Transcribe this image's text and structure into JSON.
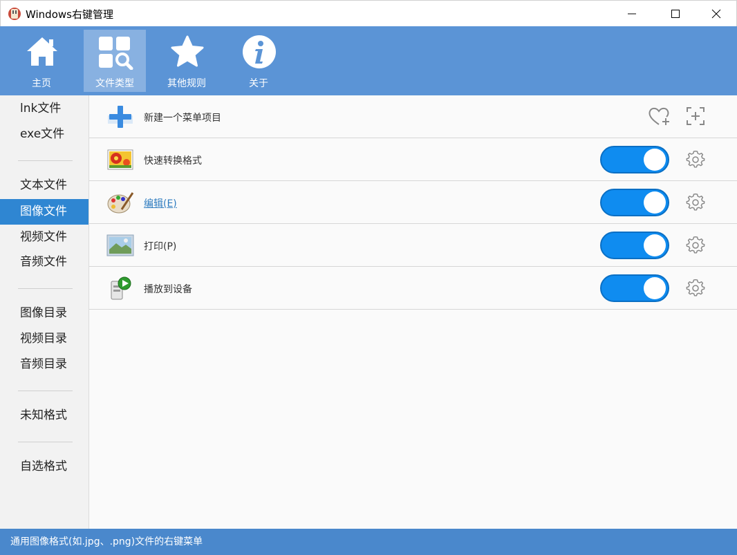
{
  "window": {
    "title": "Windows右键管理",
    "controls": [
      "minimize",
      "maximize",
      "close"
    ]
  },
  "toolbar": {
    "items": [
      {
        "label": "主页",
        "icon": "home-icon",
        "active": false
      },
      {
        "label": "文件类型",
        "icon": "file-types-search-icon",
        "active": true
      },
      {
        "label": "其他规则",
        "icon": "star-icon",
        "active": false
      },
      {
        "label": "关于",
        "icon": "info-icon",
        "active": false
      }
    ]
  },
  "sidebar": {
    "groups": [
      [
        "lnk文件",
        "exe文件"
      ],
      [
        "文本文件",
        "图像文件",
        "视频文件",
        "音频文件"
      ],
      [
        "图像目录",
        "视频目录",
        "音频目录"
      ],
      [
        "未知格式"
      ],
      [
        "自选格式"
      ]
    ],
    "selected": "图像文件"
  },
  "main": {
    "new_item": {
      "label": "新建一个菜单项目",
      "icon": "add-plus-icon"
    },
    "rows": [
      {
        "label": "快速转换格式",
        "icon": "image-flowers-icon",
        "enabled": true,
        "link": false
      },
      {
        "label": "编辑(E)",
        "icon": "paint-palette-icon",
        "enabled": true,
        "link": true
      },
      {
        "label": "打印(P)",
        "icon": "landscape-picture-icon",
        "enabled": true,
        "link": false
      },
      {
        "label": "播放到设备",
        "icon": "play-to-device-icon",
        "enabled": true,
        "link": false
      }
    ]
  },
  "statusbar": {
    "text": "通用图像格式(如.jpg、.png)文件的右键菜单"
  },
  "colors": {
    "toolbar_bg": "#5b94d6",
    "sidebar_selected": "#2f86d2",
    "toggle_on": "#0f8cf0",
    "statusbar_bg": "#4a88cc",
    "link": "#2d7bbf"
  }
}
